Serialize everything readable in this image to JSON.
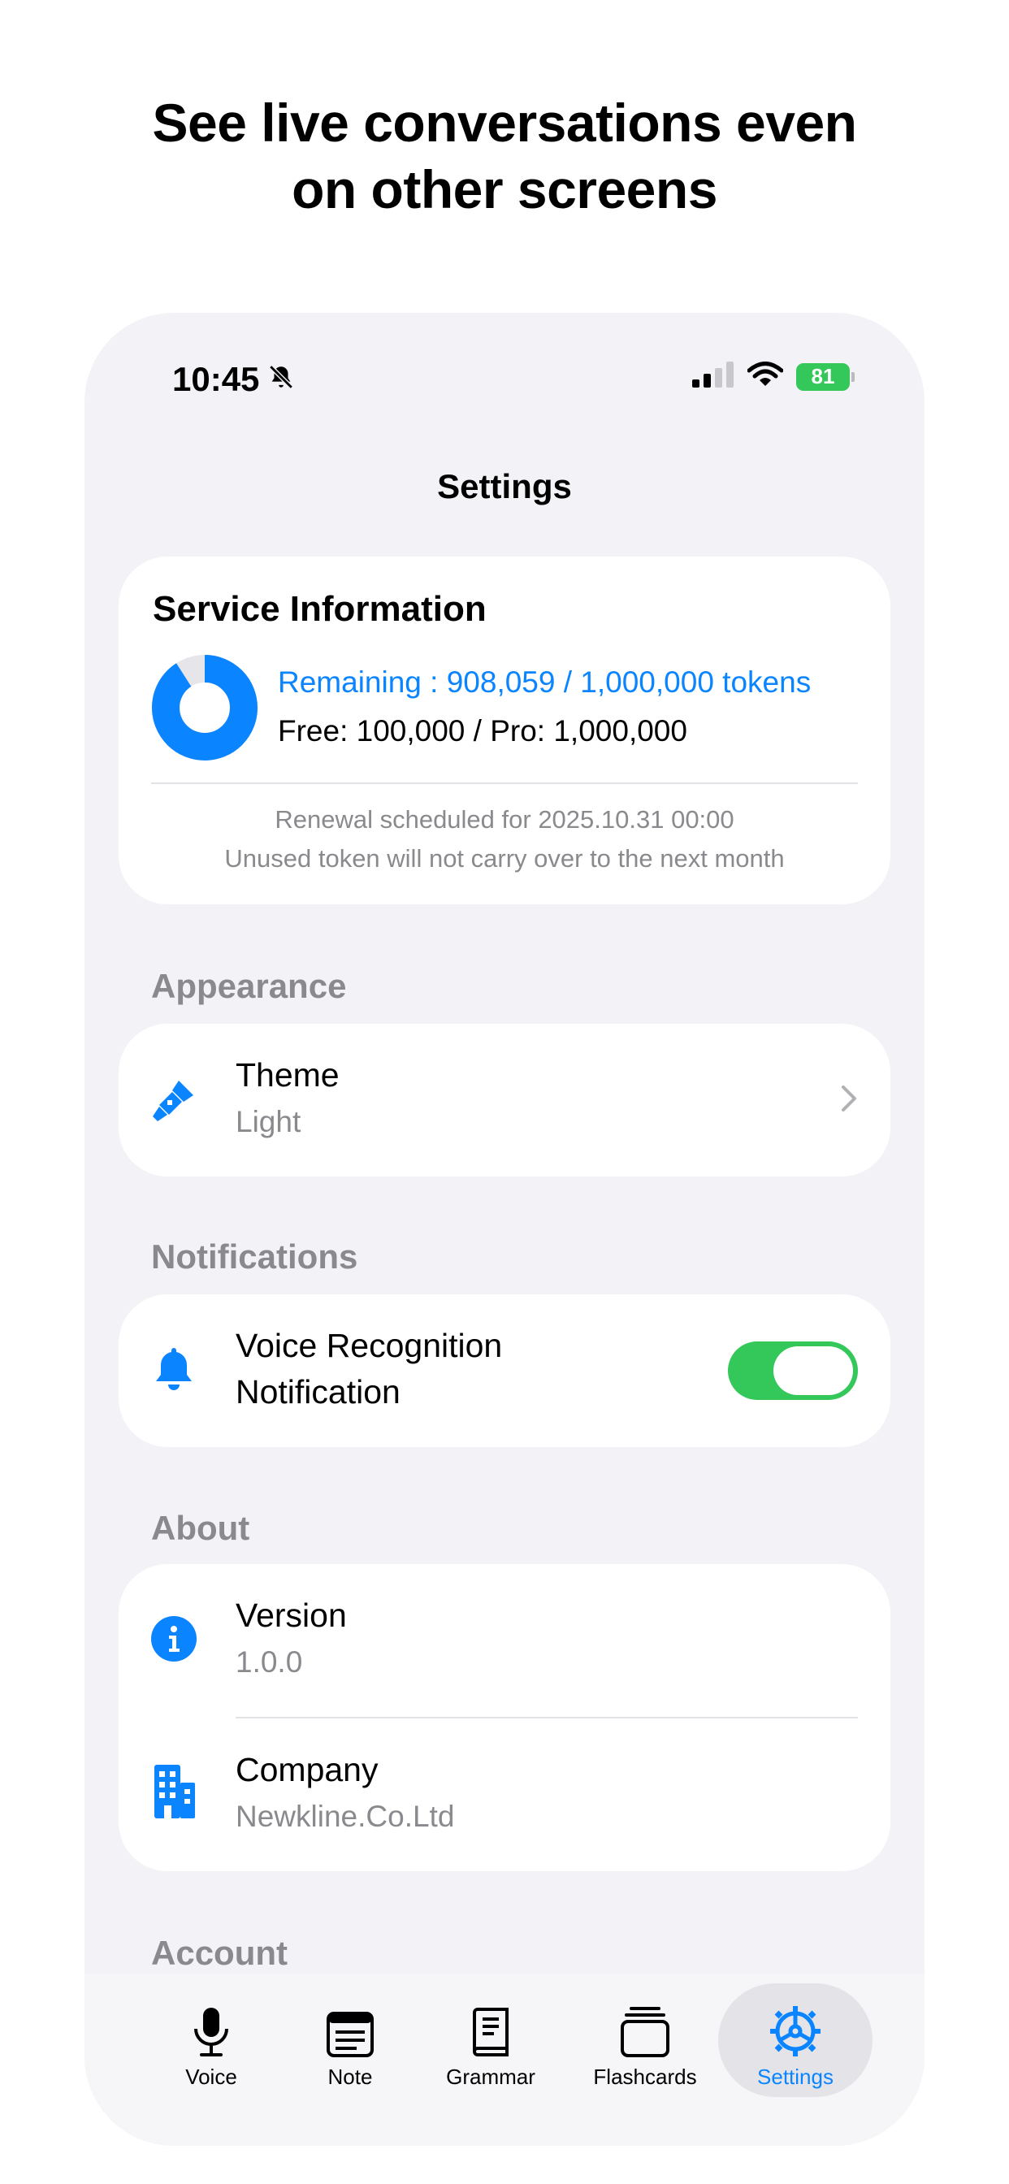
{
  "headline": [
    "See live conversations even",
    "on other screens"
  ],
  "status": {
    "time": "10:45",
    "battery": "81"
  },
  "nav": {
    "title": "Settings"
  },
  "service": {
    "title": "Service Information",
    "remaining": "Remaining : 908,059 / 1,000,000 tokens",
    "remaining_fraction": 0.908059,
    "plan": "Free: 100,000 / Pro: 1,000,000",
    "renewal": "Renewal scheduled for 2025.10.31 00:00",
    "carryover": "Unused token will not carry over to the next month"
  },
  "sections": {
    "appearance": "Appearance",
    "notifications": "Notifications",
    "about": "About",
    "account": "Account"
  },
  "appearance": {
    "theme_title": "Theme",
    "theme_value": "Light"
  },
  "notifications": {
    "voice_title_1": "Voice Recognition",
    "voice_title_2": "Notification",
    "voice_enabled": true
  },
  "about": {
    "version_title": "Version",
    "version_value": "1.0.0",
    "company_title": "Company",
    "company_value": "Newkline.Co.Ltd"
  },
  "tabs": [
    {
      "label": "Voice",
      "icon": "microphone-icon"
    },
    {
      "label": "Note",
      "icon": "note-icon"
    },
    {
      "label": "Grammar",
      "icon": "book-icon"
    },
    {
      "label": "Flashcards",
      "icon": "cards-icon"
    },
    {
      "label": "Settings",
      "icon": "gear-icon",
      "active": true
    }
  ],
  "colors": {
    "accent": "#0a84ff",
    "toggle_on": "#34c759",
    "background": "#f2f2f7"
  }
}
